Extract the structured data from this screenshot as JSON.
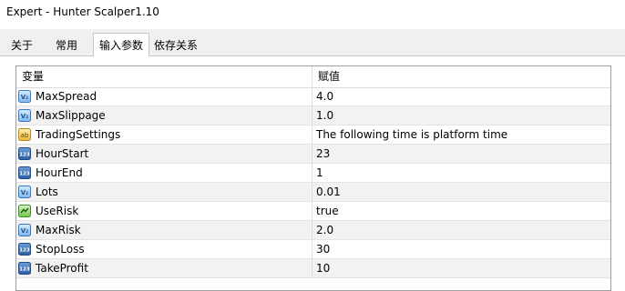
{
  "window": {
    "title": "Expert - Hunter Scalper1.10"
  },
  "tabs": [
    {
      "label": "关于"
    },
    {
      "label": "常用"
    },
    {
      "label": "输入参数",
      "active": true
    },
    {
      "label": "依存关系"
    }
  ],
  "grid": {
    "columns": {
      "name": "变量",
      "value": "赋值"
    },
    "rows": [
      {
        "name": "MaxSpread",
        "value": "4.0",
        "icon": "double-value-icon"
      },
      {
        "name": "MaxSlippage",
        "value": "1.0",
        "icon": "double-value-icon"
      },
      {
        "name": "TradingSettings",
        "value": "The following time is platform time",
        "icon": "string-value-icon"
      },
      {
        "name": "HourStart",
        "value": "23",
        "icon": "integer-value-icon"
      },
      {
        "name": "HourEnd",
        "value": "1",
        "icon": "integer-value-icon"
      },
      {
        "name": "Lots",
        "value": "0.01",
        "icon": "double-value-icon"
      },
      {
        "name": "UseRisk",
        "value": "true",
        "icon": "bool-value-icon"
      },
      {
        "name": "MaxRisk",
        "value": "2.0",
        "icon": "double-value-icon"
      },
      {
        "name": "StopLoss",
        "value": "30",
        "icon": "integer-value-icon"
      },
      {
        "name": "TakeProfit",
        "value": "10",
        "icon": "integer-value-icon"
      }
    ]
  }
}
